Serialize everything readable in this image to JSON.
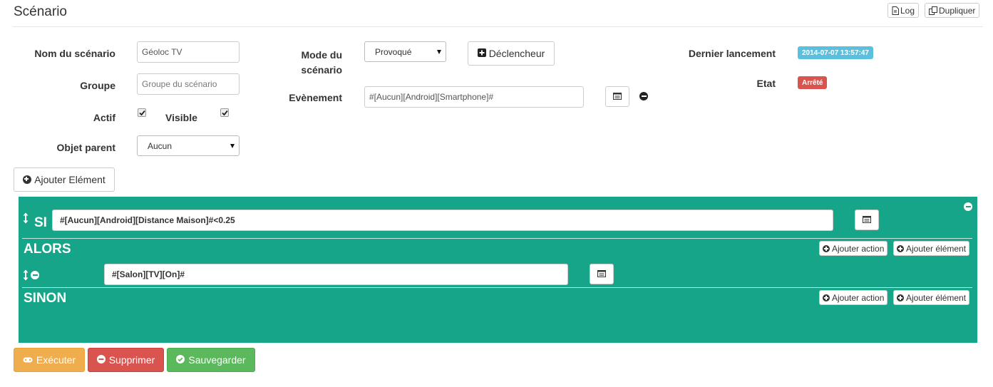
{
  "header": {
    "title": "Scénario",
    "log_label": "Log",
    "duplicate_label": "Dupliquer"
  },
  "form": {
    "name_label": "Nom du scénario",
    "name_value": "Géoloc TV",
    "group_label": "Groupe",
    "group_placeholder": "Groupe du scénario",
    "active_label": "Actif",
    "active_checked": true,
    "visible_label": "Visible",
    "visible_checked": true,
    "parent_label": "Objet parent",
    "parent_value": "Aucun",
    "mode_label_line1": "Mode du",
    "mode_label_line2": "scénario",
    "mode_value": "Provoqué",
    "trigger_button": "Déclencheur",
    "event_label": "Evènement",
    "event_value": "#[Aucun][Android][Smartphone]#",
    "last_run_label": "Dernier lancement",
    "last_run_value": "2014-07-07 13:57:47",
    "state_label": "Etat",
    "state_value": "Arrêté",
    "add_element_button": "Ajouter Elément"
  },
  "block": {
    "if_label": "SI",
    "if_condition": "#[Aucun][Android][Distance Maison]#<0.25",
    "then_label": "ALORS",
    "then_action": "#[Salon][TV][On]#",
    "else_label": "SINON",
    "add_action_label": "Ajouter action",
    "add_element_label": "Ajouter élément"
  },
  "footer": {
    "execute_label": "Exécuter",
    "delete_label": "Supprimer",
    "save_label": "Sauvegarder"
  },
  "colors": {
    "block_bg": "#17a589",
    "info_badge": "#5bc0de",
    "danger_badge": "#d9534f",
    "warning": "#f0ad4e",
    "danger": "#d9534f",
    "success": "#5cb85c"
  }
}
